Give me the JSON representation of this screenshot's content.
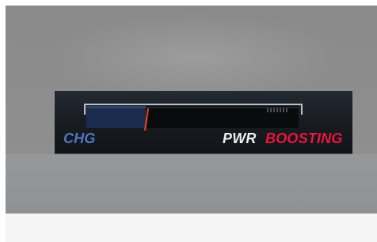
{
  "hud": {
    "charge_label": "CHG",
    "power_label": "PWR",
    "status_label": "BOOSTING",
    "charge_level_percent": 28
  },
  "colors": {
    "charge": "#5076c4",
    "boost": "#e8173c",
    "power_text": "#eeeeee",
    "needle": "#e0431a"
  }
}
